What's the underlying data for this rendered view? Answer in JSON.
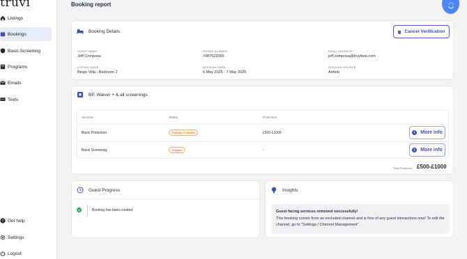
{
  "sidebar": {
    "logo": "truvi",
    "items": [
      {
        "label": "Listings",
        "icon": "home-icon"
      },
      {
        "label": "Bookings",
        "icon": "bookings-icon",
        "active": true
      },
      {
        "label": "Basic Screening",
        "icon": "shield-icon"
      },
      {
        "label": "Programs",
        "icon": "programs-icon"
      },
      {
        "label": "Emails",
        "icon": "mail-icon"
      },
      {
        "label": "Texts",
        "icon": "chat-icon"
      }
    ],
    "bottom_items": [
      {
        "label": "Get help",
        "icon": "help-icon"
      },
      {
        "label": "Settings",
        "icon": "gear-icon"
      },
      {
        "label": "Logout",
        "icon": "power-icon"
      }
    ]
  },
  "page": {
    "title": "Booking report"
  },
  "booking_details": {
    "title": "Booking Details",
    "cancel_label": "Cancel Verification",
    "fields": {
      "guest_name": {
        "label": "GUEST NAME",
        "value": "Jeff Composa"
      },
      "phone_number": {
        "label": "PHONE NUMBER",
        "value": "7487523366"
      },
      "email": {
        "label": "EMAIL ADDRESS",
        "value": "jeff.composa@truvitest.com"
      },
      "listing_name": {
        "label": "LISTING NAME",
        "value": "Bingo Villa - Bedroom 2"
      },
      "booking_date": {
        "label": "BOOKING DATE",
        "value": "6 May 2025 - 7 May 2025"
      },
      "booking_source": {
        "label": "BOOKING SOURCE",
        "value": "Airbnb"
      }
    }
  },
  "screenings": {
    "title": "BP, Waiver + & all screenings",
    "columns": [
      "Services",
      "Status",
      "Protection"
    ],
    "rows": [
      {
        "service": "Basic Protection",
        "status": "Partially Protected",
        "protection": "£500-£1000",
        "action": "More info"
      },
      {
        "service": "Basic Screening",
        "status": "Flagged",
        "protection": "-",
        "action": "More info"
      }
    ],
    "total_label": "Total Protection",
    "total_value": "£500-£1000"
  },
  "guest_progress": {
    "title": "Guest Progress",
    "events": [
      "Booking has been created"
    ]
  },
  "insights": {
    "title": "Insights",
    "message_title": "Guest facing services removed successfully!",
    "message_body": "This booking comes from an excluded channel and is free of any guest interactions now! To edit the channel, go to \"Settings / Channel Management\""
  },
  "colors": {
    "accent": "#3b4fb5",
    "fab": "#4f86f7",
    "warning": "#f2b365",
    "success": "#22a65a"
  }
}
